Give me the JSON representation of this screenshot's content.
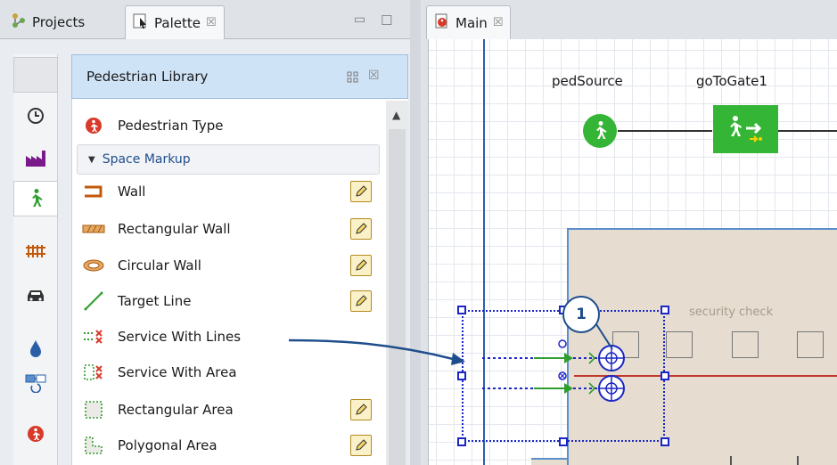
{
  "left_panel": {
    "tabs": [
      {
        "label": "Projects"
      },
      {
        "label": "Palette",
        "close": "☒"
      }
    ],
    "window_controls": {
      "minimize": "▭",
      "maximize": "☐"
    },
    "library": {
      "title": "Pedestrian Library",
      "top_item": {
        "label": "Pedestrian Type"
      },
      "section": {
        "label": "Space Markup"
      },
      "items": [
        {
          "label": "Wall",
          "editable": true
        },
        {
          "label": "Rectangular Wall",
          "editable": true
        },
        {
          "label": "Circular Wall",
          "editable": true
        },
        {
          "label": "Target Line",
          "editable": true
        },
        {
          "label": "Service With Lines",
          "editable": false
        },
        {
          "label": "Service With Area",
          "editable": false
        },
        {
          "label": "Rectangular Area",
          "editable": true
        },
        {
          "label": "Polygonal Area",
          "editable": true
        }
      ]
    },
    "side_icons": [
      "blank-icon",
      "timer-icon",
      "factory-icon",
      "pedestrian-icon",
      "rail-icon",
      "car-icon",
      "fluid-drop-icon",
      "agent-icon",
      "pedestrian-type-icon"
    ]
  },
  "editor": {
    "tab": {
      "label": "Main",
      "close": "☒"
    },
    "blocks": [
      {
        "label": "pedSource"
      },
      {
        "label": "goToGate1"
      }
    ],
    "area_label": "security check",
    "callout": {
      "number": "1"
    }
  },
  "colors": {
    "accent_blue": "#1b27c4",
    "ped_green": "#35b535",
    "selection_bg": "#cfe3f7",
    "area_fill": "#e6ddd0",
    "red_line": "#c0392b"
  }
}
